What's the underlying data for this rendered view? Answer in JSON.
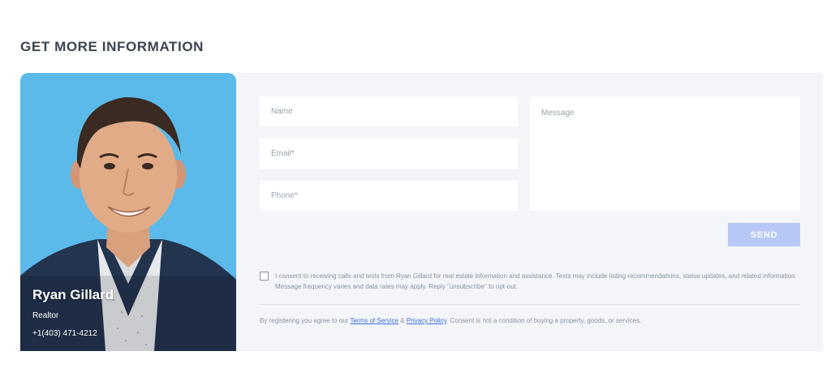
{
  "section": {
    "title": "GET MORE INFORMATION"
  },
  "agent": {
    "name": "Ryan Gillard",
    "role": "Realtor",
    "phone": "+1(403) 471-4212"
  },
  "form": {
    "name_placeholder": "Name",
    "email_placeholder": "Email*",
    "phone_placeholder": "Phone*",
    "message_placeholder": "Message",
    "send_label": "SEND",
    "consent_text": "I consent to receiving calls and texts from Ryan Gillard for real estate information and assistance. Texts may include listing recommendations, status updates, and related information. Message frequency varies and data rates may apply. Reply \"unsubscribe\" to opt-out.",
    "consent_checked": false
  },
  "legal": {
    "prefix": "By registering you agree to our ",
    "terms_label": "Terms of Service",
    "joiner": " & ",
    "privacy_label": "Privacy Policy",
    "suffix": ". Consent is not a condition of buying a property, goods, or services."
  },
  "colors": {
    "accent": "#b8c8f6",
    "card_bg": "#5bbaea",
    "panel_bg": "#f3f5f9",
    "link": "#3d6fdc"
  }
}
